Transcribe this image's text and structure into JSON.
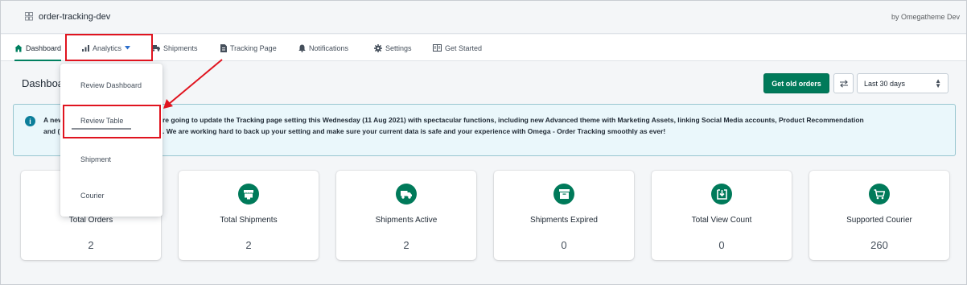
{
  "app": {
    "title": "order-tracking-dev",
    "by": "by Omegatheme Dev"
  },
  "nav": {
    "dashboard": "Dashboard",
    "analytics": "Analytics",
    "shipments": "Shipments",
    "tracking_page": "Tracking Page",
    "notifications": "Notifications",
    "settings": "Settings",
    "get_started": "Get Started"
  },
  "page": {
    "title": "Dashboa"
  },
  "header_actions": {
    "get_old_orders": "Get old orders",
    "date_range": "Last 30 days",
    "date_range_options": [
      "Last 30 days"
    ]
  },
  "banner": {
    "line1_left": "A new",
    "line1_right": "re going to update the Tracking page setting this Wednesday (11 Aug 2021) with spectacular functions, including new Advanced theme with Marketing Assets, linking Social Media accounts, Product Recommendation",
    "line2_left": "and (",
    "line2_right": ". We are working hard to back up your setting and make sure your current data is safe and your experience with Omega - Order Tracking smoothly as ever!"
  },
  "analytics_menu": {
    "items": [
      "Review Dashboard",
      "Review Table",
      "Shipment",
      "Courier"
    ]
  },
  "stats": [
    {
      "label": "Total Orders",
      "value": "2",
      "icon": "cart-icon"
    },
    {
      "label": "Total Shipments",
      "value": "2",
      "icon": "store-icon"
    },
    {
      "label": "Shipments Active",
      "value": "2",
      "icon": "truck-icon"
    },
    {
      "label": "Shipments Expired",
      "value": "0",
      "icon": "archive-icon"
    },
    {
      "label": "Total View Count",
      "value": "0",
      "icon": "download-box-icon"
    },
    {
      "label": "Supported Courier",
      "value": "260",
      "icon": "cart-icon"
    }
  ],
  "colors": {
    "accent": "#007a5a",
    "highlight": "#e0141f",
    "banner_bg": "#eaf7fb",
    "banner_border": "#98c6d0",
    "info": "#0b7e9a"
  }
}
